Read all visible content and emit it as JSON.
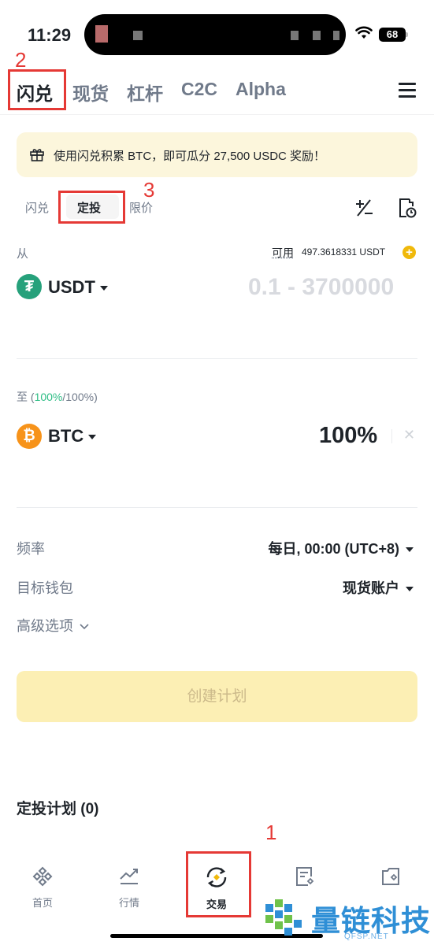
{
  "status_bar": {
    "time": "11:29",
    "battery": "68"
  },
  "markers": {
    "m1": "1",
    "m2": "2",
    "m3": "3"
  },
  "top_tabs": [
    {
      "label": "闪兑",
      "active": true
    },
    {
      "label": "现货"
    },
    {
      "label": "杠杆"
    },
    {
      "label": "C2C"
    },
    {
      "label": "Alpha"
    }
  ],
  "promo": {
    "text": "使用闪兑积累 BTC，即可瓜分 27,500 USDC 奖励！",
    "icon": "gift-icon"
  },
  "sub_tabs": [
    {
      "label": "闪兑"
    },
    {
      "label": "定投",
      "active": true
    },
    {
      "label": "限价"
    }
  ],
  "from": {
    "label": "从",
    "available_label": "可用",
    "available_value": "497.3618331 USDT",
    "add_symbol": "+",
    "token": "USDT",
    "token_glyph": "₮",
    "amount_placeholder": "0.1 - 3700000"
  },
  "to": {
    "label_prefix": "至 (",
    "label_pct": "100%",
    "label_suffix": "/100%)",
    "token": "BTC",
    "token_glyph": "₿",
    "percent": "100%",
    "close": "✕"
  },
  "settings": {
    "frequency_label": "频率",
    "frequency_value": "每日, 00:00 (UTC+8)",
    "wallet_label": "目标钱包",
    "wallet_value": "现货账户",
    "advanced_label": "高级选项"
  },
  "create_button": "创建计划",
  "plans_title": "定投计划 (0)",
  "bottom_nav": [
    {
      "label": "首页",
      "icon": "home-diamond-icon"
    },
    {
      "label": "行情",
      "icon": "chart-trend-icon"
    },
    {
      "label": "交易",
      "icon": "trade-exchange-icon",
      "active": true
    },
    {
      "label": "",
      "icon": "orders-icon"
    },
    {
      "label": "",
      "icon": "wallet-icon"
    }
  ],
  "watermark": {
    "text": "量链科技",
    "sub": "QFSP.NET"
  },
  "colors": {
    "brand_yellow": "#f0b90b",
    "green": "#2ebd85",
    "tether": "#26a17b",
    "btc": "#f7931a",
    "annotation_red": "#e53935"
  }
}
